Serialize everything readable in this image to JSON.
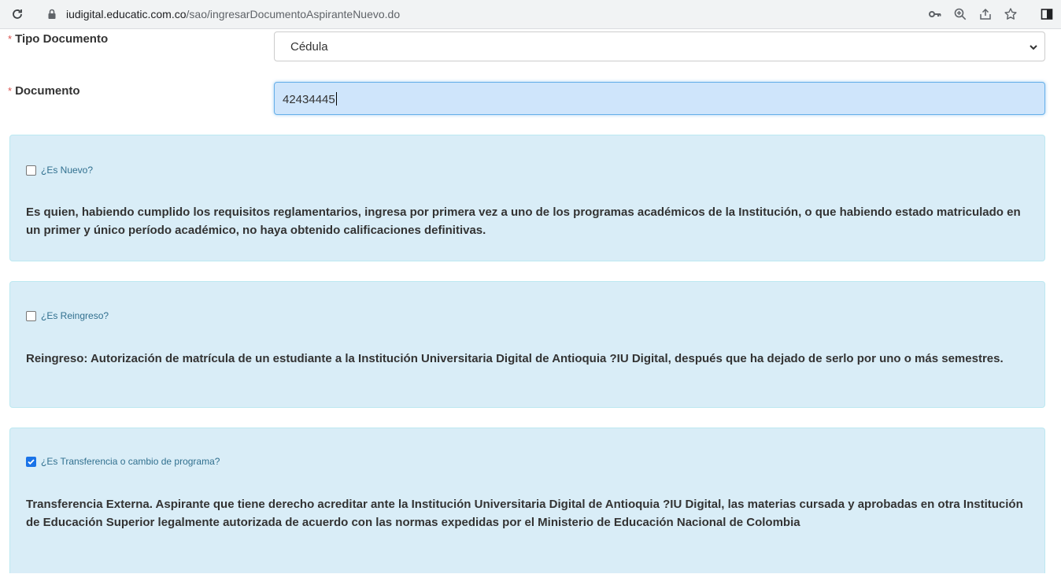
{
  "browser": {
    "url_host": "iudigital.educatic.com.co",
    "url_path": "/sao/ingresarDocumentoAspiranteNuevo.do",
    "icons": [
      "reload-icon",
      "lock-icon",
      "key-icon",
      "zoom-icon",
      "share-icon",
      "star-icon",
      "sidebar-icon"
    ]
  },
  "form": {
    "required_mark": "*",
    "tipo_documento": {
      "label": "Tipo Documento",
      "value": "Cédula"
    },
    "documento": {
      "label": "Documento",
      "value": "42434445"
    }
  },
  "panels": [
    {
      "checkbox_label": "¿Es Nuevo?",
      "checked": false,
      "text": "Es quien, habiendo cumplido los requisitos reglamentarios, ingresa por primera vez a uno de los programas académicos de la Institución, o que habiendo estado matriculado en un primer y único período académico, no haya obtenido calificaciones definitivas."
    },
    {
      "checkbox_label": "¿Es Reingreso?",
      "checked": false,
      "text": "Reingreso: Autorización de matrícula de un estudiante a la Institución Universitaria Digital de Antioquia ?IU Digital, después que ha dejado de serlo por uno o más semestres."
    },
    {
      "checkbox_label": "¿Es Transferencia o cambio de programa?",
      "checked": true,
      "text": "Transferencia Externa. Aspirante que tiene derecho acreditar ante la Institución Universitaria Digital de Antioquia ?IU Digital, las materias cursada y aprobadas en otra Institución de Educación Superior legalmente autorizada de acuerdo con las normas expedidas por el Ministerio de Educación Nacional de Colombia"
    }
  ],
  "colors": {
    "panel_bg": "#d9edf7",
    "panel_border": "#bce8f1",
    "checkbox_label": "#31708f",
    "required": "#d9534f",
    "checked": "#1a73e8"
  }
}
